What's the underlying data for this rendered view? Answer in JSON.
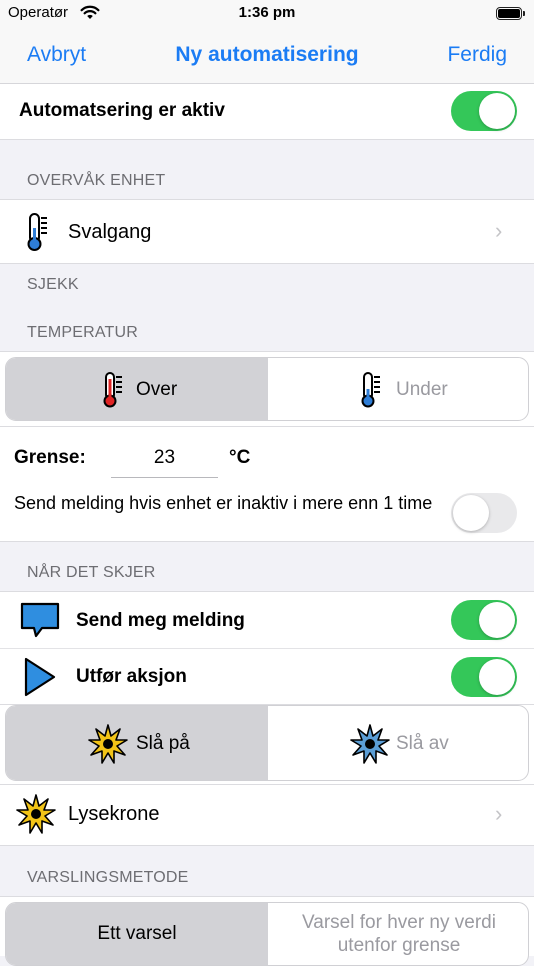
{
  "status_bar": {
    "carrier": "Operatør",
    "time": "1:36 pm"
  },
  "nav": {
    "cancel": "Avbryt",
    "title": "Ny automatisering",
    "done": "Ferdig"
  },
  "active_row": {
    "label": "Automatsering er aktiv",
    "toggle_on": true
  },
  "monitor": {
    "header": "OVERVÅK ENHET",
    "device": "Svalgang"
  },
  "check": {
    "header": "SJEKK",
    "sub_header": "TEMPERATUR"
  },
  "temp_segment": {
    "options": [
      "Over",
      "Under"
    ],
    "selected": "Over"
  },
  "limit": {
    "label": "Grense:",
    "value": "23",
    "unit": "°C"
  },
  "inactive_row": {
    "label": "Send melding hvis enhet er inaktiv i mere enn 1 time",
    "toggle_on": false
  },
  "when": {
    "header": "NÅR DET SKJER"
  },
  "notify_row": {
    "label": "Send meg melding",
    "toggle_on": true
  },
  "action_row": {
    "label": "Utfør aksjon",
    "toggle_on": true
  },
  "action_segment": {
    "options": [
      "Slå på",
      "Slå av"
    ],
    "selected": "Slå på"
  },
  "target": {
    "device": "Lysekrone"
  },
  "method": {
    "header": "VARSLINGSMETODE",
    "options": [
      "Ett varsel",
      "Varsel for hver ny verdi utenfor grense"
    ],
    "selected": "Ett varsel"
  },
  "colors": {
    "accent": "#1b7cf4",
    "toggle_on": "#34c759",
    "toggle_off": "#e9e9eb"
  }
}
